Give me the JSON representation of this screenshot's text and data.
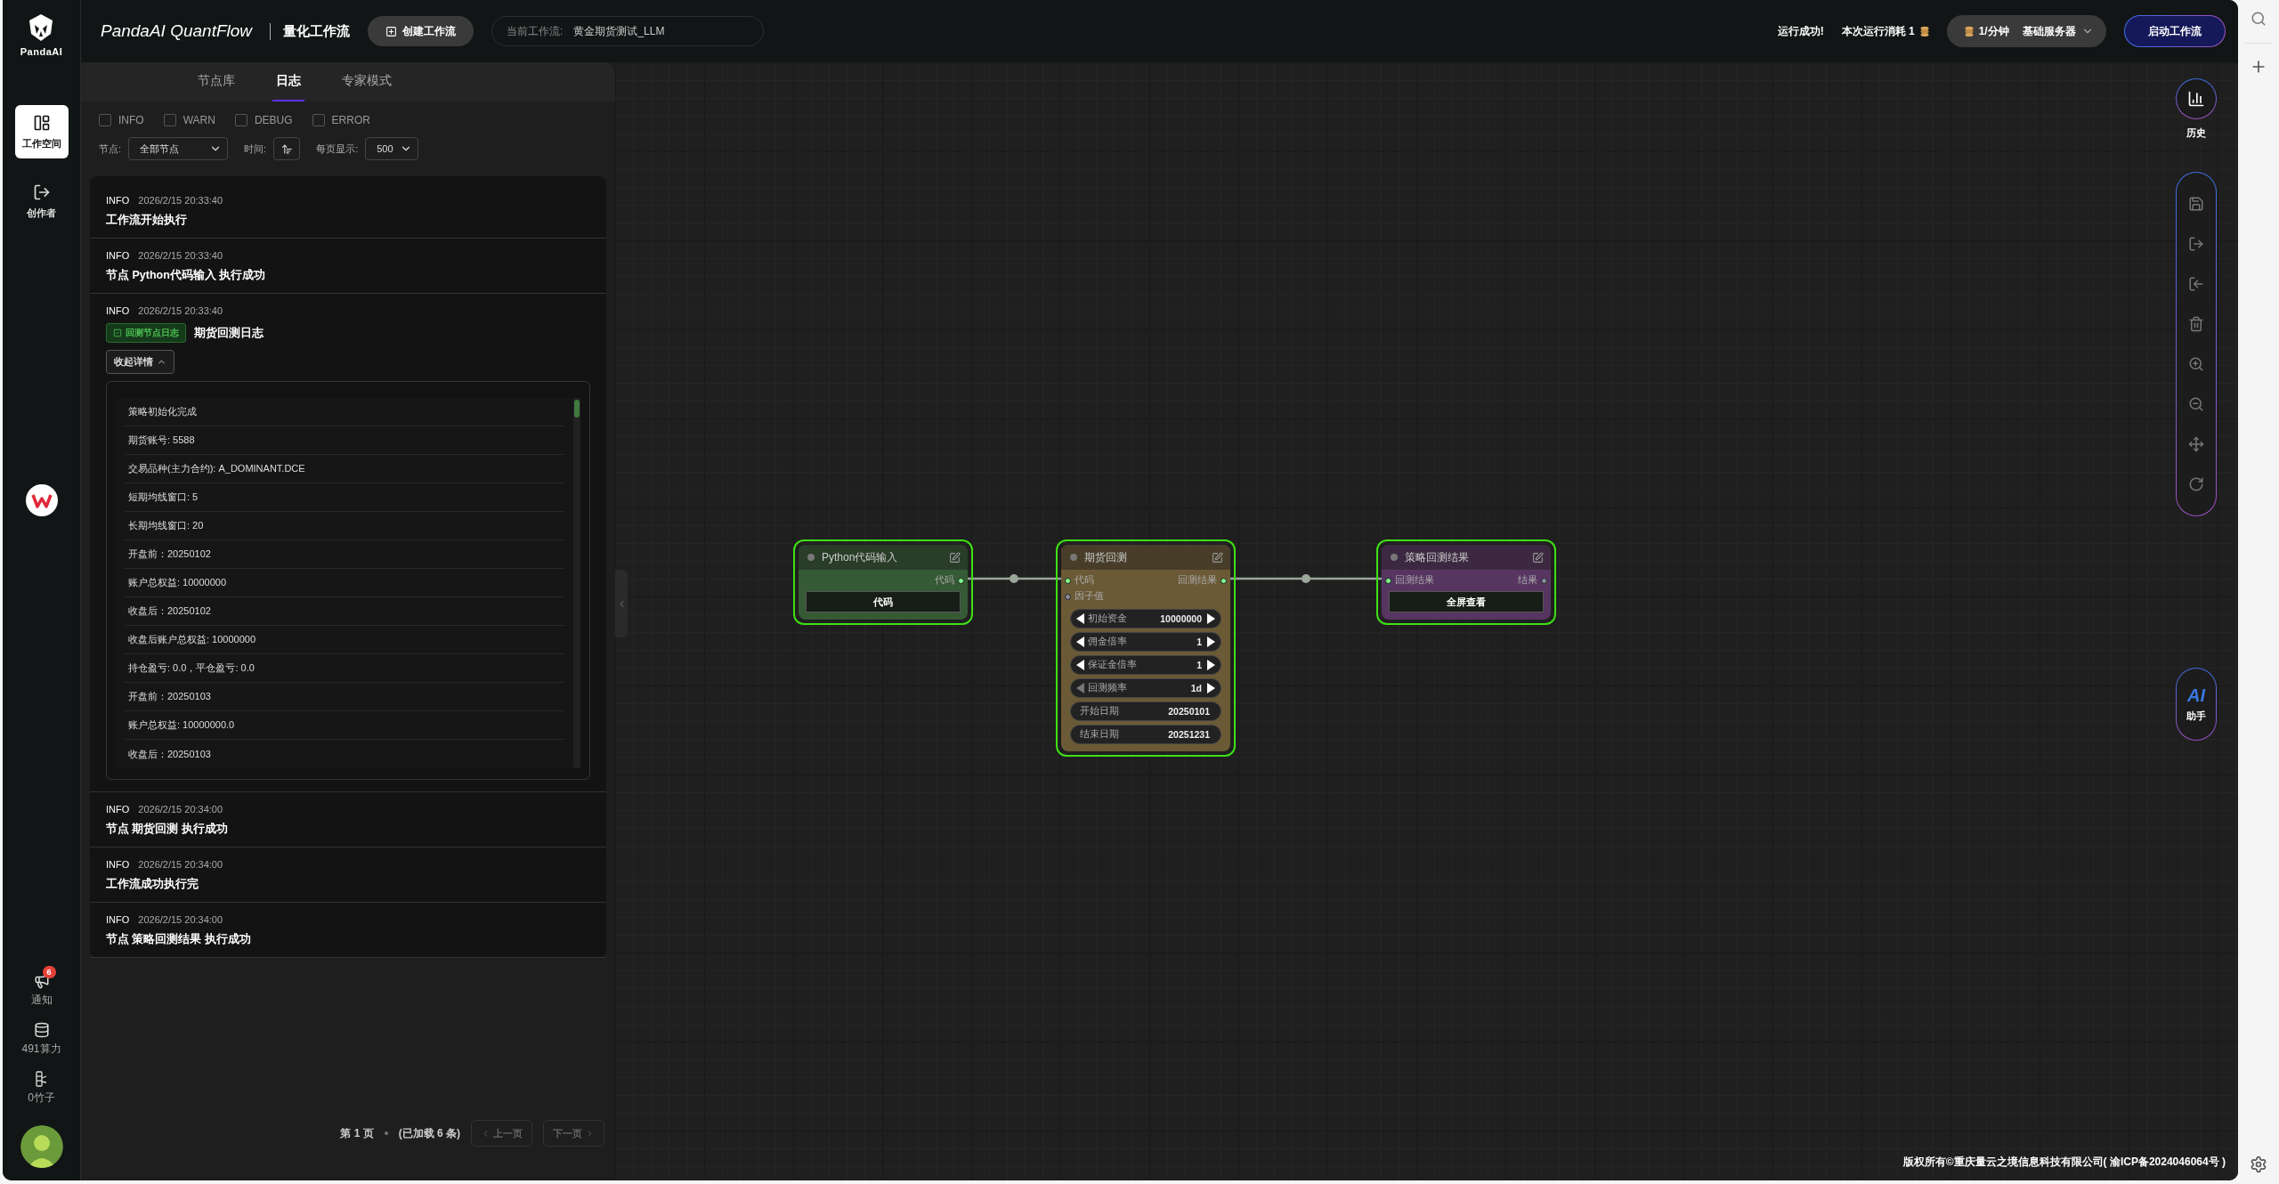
{
  "app": {
    "logo_text": "PandaAI",
    "title": "PandaAI QuantFlow",
    "subtitle": "量化工作流",
    "create_button": "创建工作流",
    "current_workflow_label": "当前工作流:",
    "current_workflow": "黄金期货测试_LLM"
  },
  "status": {
    "message": "运行成功!",
    "cost": "本次运行消耗 1"
  },
  "server": {
    "rate": "1/分钟",
    "name": "基础服务器"
  },
  "start_button": "启动工作流",
  "sidebar": {
    "items": [
      {
        "label": "工作空间",
        "kind": "workspace",
        "selected": true
      },
      {
        "label": "创作者",
        "kind": "creator",
        "selected": false
      }
    ],
    "bottom": [
      {
        "label": "通知",
        "kind": "notice",
        "badge": "6"
      },
      {
        "label": "491算力",
        "kind": "compute"
      },
      {
        "label": "0竹子",
        "kind": "bamboo"
      }
    ]
  },
  "panel": {
    "tabs": [
      {
        "label": "节点库",
        "selected": false
      },
      {
        "label": "日志",
        "selected": true
      },
      {
        "label": "专家模式",
        "selected": false
      }
    ],
    "filters": [
      {
        "label": "INFO",
        "checked": false
      },
      {
        "label": "WARN",
        "checked": false
      },
      {
        "label": "DEBUG",
        "checked": false
      },
      {
        "label": "ERROR",
        "checked": false
      }
    ],
    "node_filter": {
      "label": "节点:",
      "value": "全部节点"
    },
    "time_label": "时间:",
    "page_size": {
      "label": "每页显示:",
      "value": "500"
    },
    "logs": [
      {
        "level": "INFO",
        "time": "2026/2/15 20:33:40",
        "message": "工作流开始执行"
      },
      {
        "level": "INFO",
        "time": "2026/2/15 20:33:40",
        "message": "节点 Python代码输入 执行成功"
      },
      {
        "level": "INFO",
        "time": "2026/2/15 20:33:40",
        "tag": "回测节点日志",
        "message": "期货回测日志",
        "toggle": "收起详情",
        "details": [
          "策略初始化完成",
          "期货账号: 5588",
          "交易品种(主力合约): A_DOMINANT.DCE",
          "短期均线窗口: 5",
          "长期均线窗口: 20",
          "开盘前：20250102",
          "账户总权益: 10000000",
          "收盘后：20250102",
          "收盘后账户总权益: 10000000",
          "持仓盈亏: 0.0，平仓盈亏: 0.0",
          "开盘前：20250103",
          "账户总权益: 10000000.0",
          "收盘后：20250103"
        ]
      },
      {
        "level": "INFO",
        "time": "2026/2/15 20:34:00",
        "message": "节点 期货回测 执行成功"
      },
      {
        "level": "INFO",
        "time": "2026/2/15 20:34:00",
        "message": "工作流成功执行完"
      },
      {
        "level": "INFO",
        "time": "2026/2/15 20:34:00",
        "message": "节点 策略回测结果 执行成功"
      }
    ],
    "pagination": {
      "page": "第 1 页",
      "loaded": "(已加载 6 条)",
      "prev": {
        "label": "上一页",
        "disabled": true
      },
      "next": {
        "label": "下一页",
        "disabled": true
      }
    }
  },
  "nodes": [
    {
      "title": "Python代码输入",
      "color": "#355a35",
      "selected": true,
      "outputs": [
        {
          "label": "代码",
          "connected": true
        }
      ],
      "widgets": [
        {
          "kind": "button",
          "label": "代码"
        }
      ]
    },
    {
      "title": "期货回测",
      "color": "#6b5a36",
      "selected": true,
      "inputs": [
        {
          "label": "代码",
          "connected": true
        },
        {
          "label": "因子值",
          "connected": false
        }
      ],
      "outputs": [
        {
          "label": "回测结果",
          "connected": true
        }
      ],
      "widgets": [
        {
          "kind": "stepper",
          "label": "初始资金",
          "value": "10000000",
          "can_decrease": true
        },
        {
          "kind": "stepper",
          "label": "佣金倍率",
          "value": "1",
          "can_decrease": true
        },
        {
          "kind": "stepper",
          "label": "保证金倍率",
          "value": "1",
          "can_decrease": true
        },
        {
          "kind": "stepper",
          "label": "回测频率",
          "value": "1d",
          "can_decrease": false
        },
        {
          "kind": "text",
          "label": "开始日期",
          "value": "20250101"
        },
        {
          "kind": "text",
          "label": "结束日期",
          "value": "20251231"
        }
      ]
    },
    {
      "title": "策略回测结果",
      "color": "#573561",
      "selected": true,
      "inputs": [
        {
          "label": "回测结果",
          "connected": true
        }
      ],
      "outputs": [
        {
          "label": "结果",
          "connected": false
        }
      ],
      "widgets": [
        {
          "kind": "button",
          "label": "全屏查看"
        }
      ]
    }
  ],
  "toolbar": {
    "history": "历史",
    "assistant": {
      "mark": "AI",
      "label": "助手"
    }
  },
  "footer": "版权所有©重庆量云之境信息科技有限公司( 渝ICP备2024046064号 )"
}
